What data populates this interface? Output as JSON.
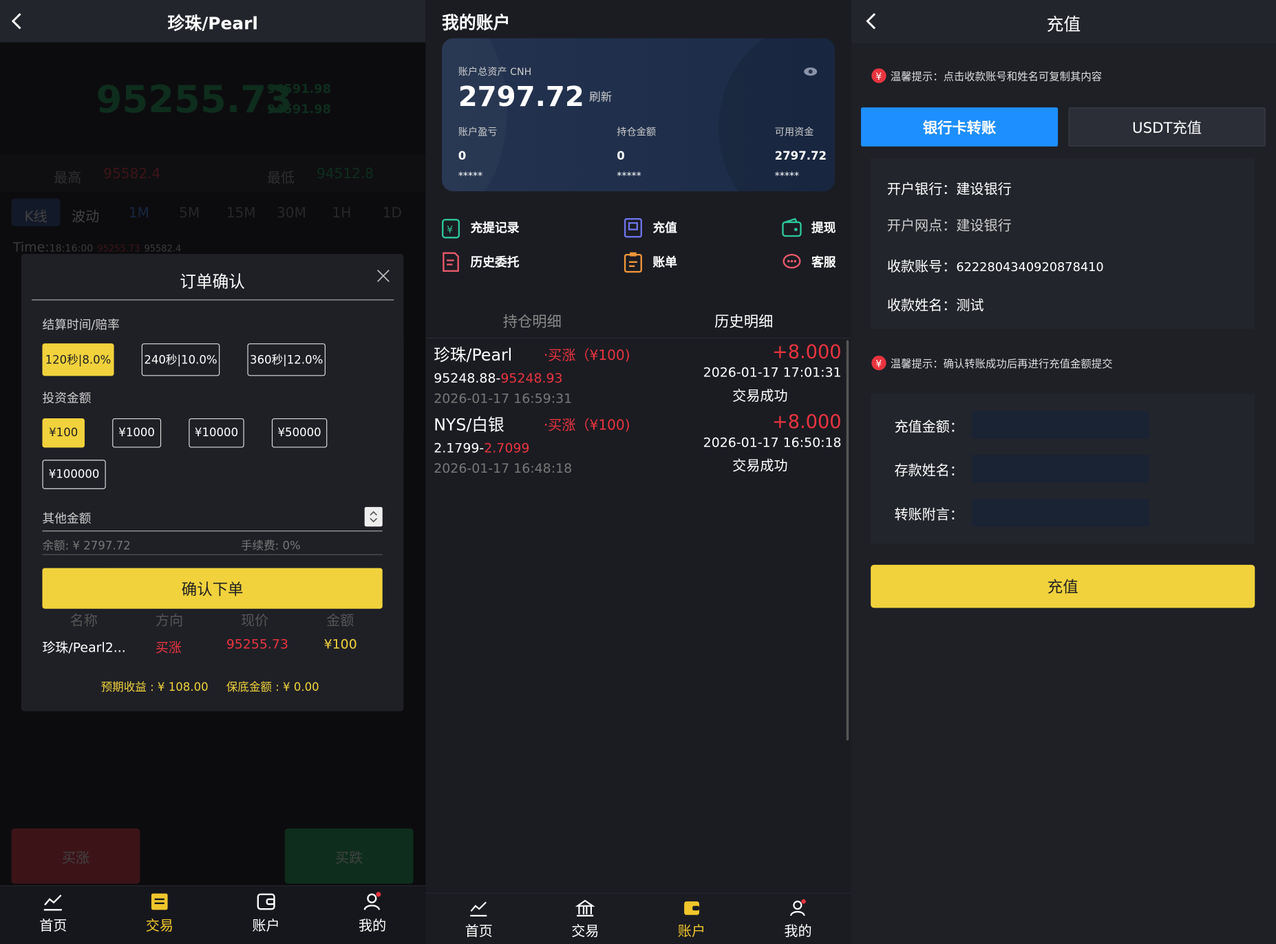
{
  "left": {
    "header": {
      "title": "珍珠/Pearl"
    },
    "quote": {
      "price": "95255.73",
      "sub1": "94591.98",
      "sub2": "94591.98",
      "high_label": "最高",
      "high": "95582.4",
      "low_label": "最低",
      "low": "94512.8"
    },
    "period_tabs": [
      "K线",
      "波动",
      "1M",
      "5M",
      "15M",
      "30M",
      "1H",
      "1D"
    ],
    "time_row": {
      "label": "Time:",
      "time": "18:16:00",
      "v1": "95255.73",
      "v2": "95582.4"
    },
    "buy_up": "买涨",
    "buy_down": "买跌",
    "modal": {
      "title": "订单确认",
      "settle_label": "结算时间/赔率",
      "settle_options": [
        "120秒|8.0%",
        "240秒|10.0%",
        "360秒|12.0%"
      ],
      "invest_label": "投资金额",
      "invest_options": [
        "¥100",
        "¥1000",
        "¥10000",
        "¥50000",
        "¥100000"
      ],
      "other_label": "其他金额",
      "balance": "余额: ¥ 2797.72",
      "fee": "手续费: 0%",
      "confirm": "确认下单",
      "table_headers": [
        "名称",
        "方向",
        "现价",
        "金额"
      ],
      "row": {
        "name": "珍珠/Pearl2...",
        "direction": "买涨",
        "price": "95255.73",
        "amount": "¥100"
      },
      "expected": "预期收益 : ¥ 108.00",
      "guarantee": "保底金额 : ¥ 0.00"
    },
    "tabs": [
      "首页",
      "交易",
      "账户",
      "我的"
    ]
  },
  "middle": {
    "header": {
      "title": "我的账户"
    },
    "card": {
      "total_label": "账户总资产 CNH",
      "total": "2797.72",
      "refresh": "刷新",
      "pl_label": "账户盈亏",
      "pl": "0",
      "hold_label": "持仓金额",
      "hold": "0",
      "avail_label": "可用资金",
      "avail": "2797.72",
      "mask": "*****"
    },
    "menu": [
      "充提记录",
      "充值",
      "提现",
      "历史委托",
      "账单",
      "客服"
    ],
    "list_tabs": [
      "持仓明细",
      "历史明细"
    ],
    "records": [
      {
        "name": "珍珠/Pearl",
        "dir": "·买涨（¥100)",
        "range_a": "95248.88-",
        "range_b": "95248.93",
        "open": "2026-01-17 16:59:31",
        "profit": "+8.000",
        "close": "2026-01-17 17:01:31",
        "status": "交易成功"
      },
      {
        "name": "NYS/白银",
        "dir": "·买涨（¥100)",
        "range_a": "2.1799-",
        "range_b": "2.7099",
        "open": "2026-01-17 16:48:18",
        "profit": "+8.000",
        "close": "2026-01-17 16:50:18",
        "status": "交易成功"
      }
    ],
    "tabs": [
      "首页",
      "交易",
      "账户",
      "我的"
    ]
  },
  "right": {
    "header": {
      "title": "充值"
    },
    "tip1": "温馨提示：点击收款账号和姓名可复制其内容",
    "tabs_top": [
      "银行卡转账",
      "USDT充值"
    ],
    "bank": {
      "bank_label": "开户银行：",
      "bank": "建设银行",
      "branch_label": "开户网点：",
      "branch": "建设银行",
      "acct_label": "收款账号：",
      "acct": "6222804340920878410",
      "name_label": "收款姓名：",
      "name": "测试"
    },
    "tip2": "温馨提示：确认转账成功后再进行充值金额提交",
    "form": {
      "amount_label": "充值金额：",
      "depositor_label": "存款姓名：",
      "note_label": "转账附言："
    },
    "submit": "充值"
  },
  "colors": {
    "yellow": "#f1d23c",
    "red": "#e8343f",
    "green": "#19a557",
    "blue": "#1e90ff"
  }
}
